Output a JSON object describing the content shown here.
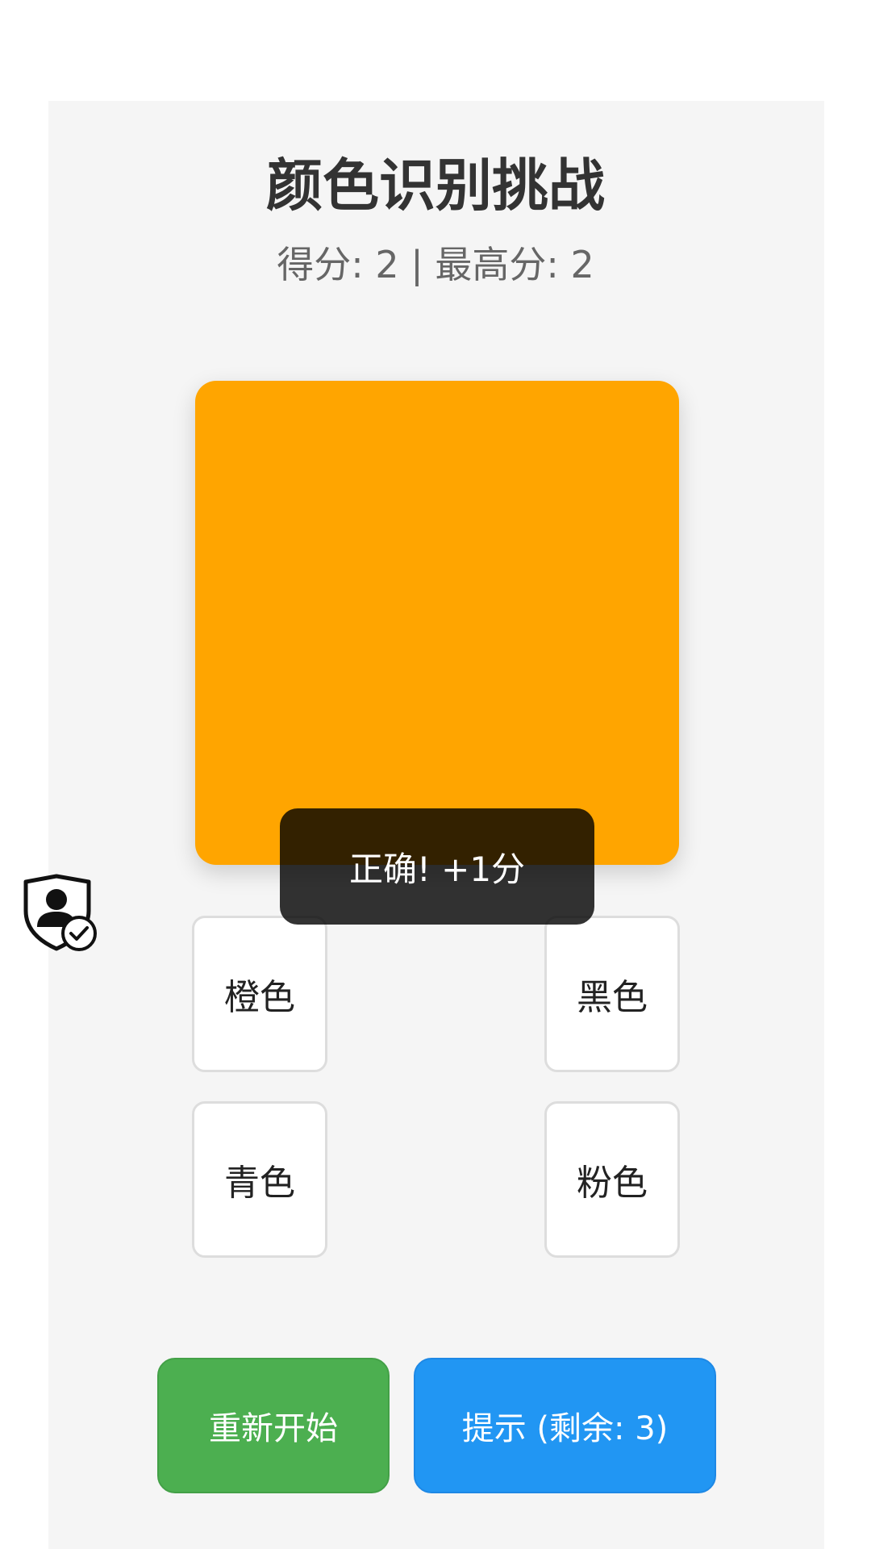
{
  "app": {
    "title": "颜色识别挑战",
    "score_line": "得分: 2 | 最高分: 2"
  },
  "game": {
    "current_color": "#ffa500",
    "feedback": "正确! +1分",
    "options": [
      {
        "label": "橙色"
      },
      {
        "label": "黑色"
      },
      {
        "label": "青色"
      },
      {
        "label": "粉色"
      }
    ]
  },
  "controls": {
    "restart_label": "重新开始",
    "hint_label": "提示 (剩余: 3)"
  },
  "colors": {
    "panel_bg": "#f5f5f5",
    "restart": "#4caf50",
    "hint": "#2196f3",
    "toast": "#000000"
  },
  "icons": {
    "floating": "shield-user-check-icon"
  }
}
